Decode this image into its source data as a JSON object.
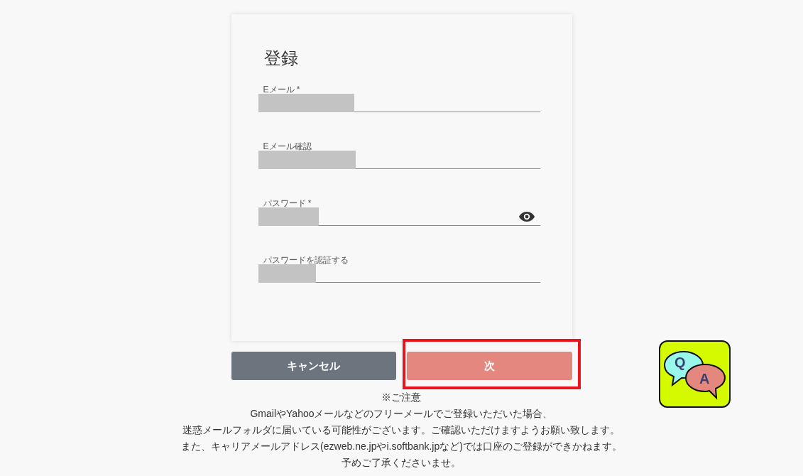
{
  "form": {
    "title": "登録",
    "fields": [
      {
        "label": "Eメール *",
        "redacted": true,
        "reveal_toggle": false
      },
      {
        "label": "Eメール確認",
        "redacted": true,
        "reveal_toggle": false
      },
      {
        "label": "パスワード *",
        "redacted": true,
        "reveal_toggle": true
      },
      {
        "label": "パスワードを認証する",
        "redacted": true,
        "reveal_toggle": false
      }
    ]
  },
  "buttons": [
    {
      "label": "キャンセル",
      "kind": "secondary",
      "highlighted": false
    },
    {
      "label": "次",
      "kind": "primary",
      "highlighted": true
    }
  ],
  "notice": {
    "heading": "※ご注意",
    "lines": [
      "GmailやYahooメールなどのフリーメールでご登録いただいた場合、",
      "迷惑メールフォルダに届いている可能性がございます。ご確認いただけますようお願い致します。",
      "また、キャリアメールアドレス(ezweb.ne.jpやi.softbank.jpなど)では口座のご登録ができかねます。",
      "予めご了承くださいませ。"
    ]
  },
  "help_badge": {
    "question": "Q",
    "answer": "A"
  }
}
